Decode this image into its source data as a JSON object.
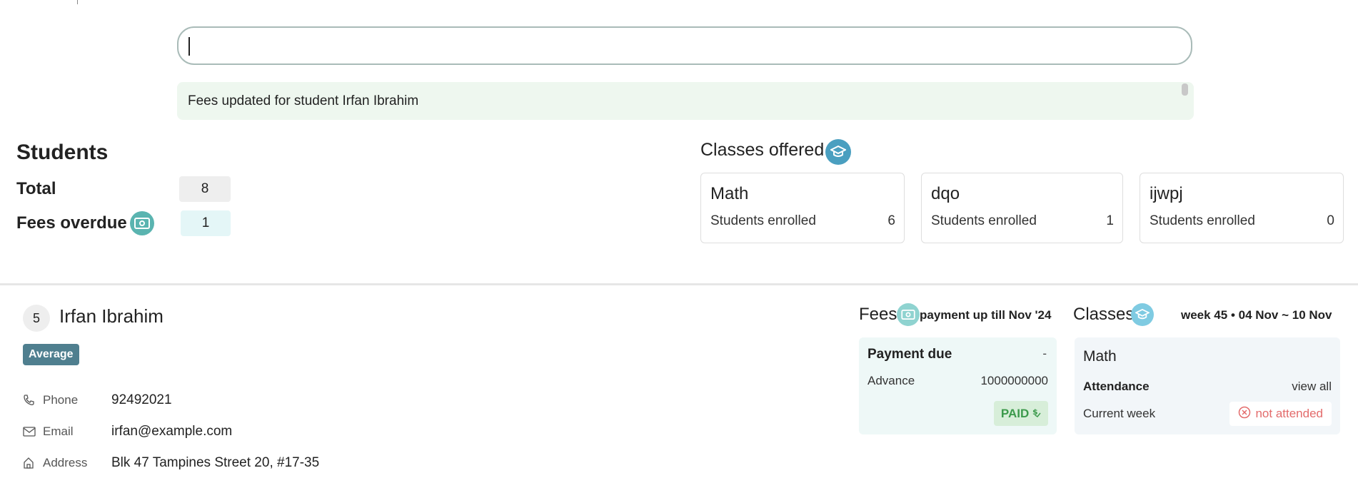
{
  "command": {
    "value": ""
  },
  "feedback": {
    "message": "Fees updated for student Irfan Ibrahim"
  },
  "students": {
    "heading": "Students",
    "total_label": "Total",
    "total_value": "8",
    "overdue_label": "Fees overdue",
    "overdue_value": "1"
  },
  "classes_offered": {
    "heading": "Classes offered",
    "items": [
      {
        "name": "Math",
        "enrolled_label": "Students enrolled",
        "enrolled": "6"
      },
      {
        "name": "dqo",
        "enrolled_label": "Students enrolled",
        "enrolled": "1"
      },
      {
        "name": "ijwpj",
        "enrolled_label": "Students enrolled",
        "enrolled": "0"
      }
    ]
  },
  "student": {
    "index": "5",
    "name": "Irfan Ibrahim",
    "grade_badge": "Average",
    "phone_label": "Phone",
    "phone": "92492021",
    "email_label": "Email",
    "email": "irfan@example.com",
    "address_label": "Address",
    "address": "Blk 47 Tampines Street 20, #17-35"
  },
  "fees": {
    "heading": "Fees",
    "subtitle": "payment up till Nov '24",
    "due_label": "Payment due",
    "due_value": "-",
    "advance_label": "Advance",
    "advance_value": "1000000000",
    "status": "PAID"
  },
  "classes": {
    "heading": "Classes",
    "week": "week 45 • 04 Nov ~ 10 Nov",
    "class_name": "Math",
    "attendance_label": "Attendance",
    "view_all": "view all",
    "current_week_label": "Current week",
    "current_week_status": "not attended"
  },
  "colors": {
    "accent_teal": "#5ab4b0",
    "accent_blue": "#4a9fc0",
    "badge": "#4f7f8f",
    "paid_green": "#3c9a4c",
    "not_attended_red": "#e36b6b"
  }
}
